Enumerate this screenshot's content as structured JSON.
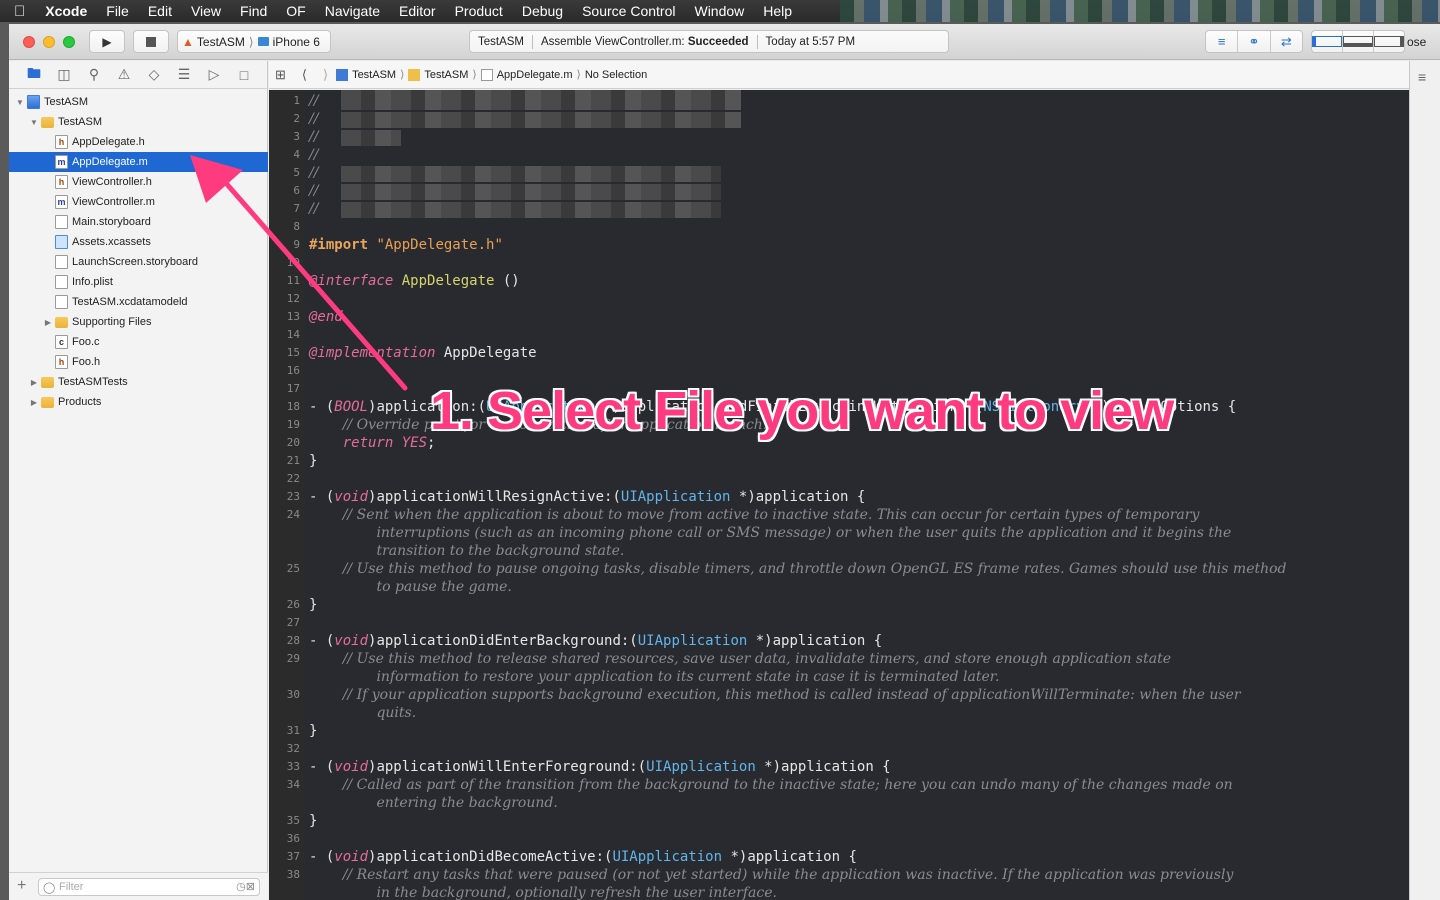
{
  "menubar": {
    "app": "Xcode",
    "items": [
      "File",
      "Edit",
      "View",
      "Find",
      "OF",
      "Navigate",
      "Editor",
      "Product",
      "Debug",
      "Source Control",
      "Window",
      "Help"
    ]
  },
  "toolbar": {
    "scheme": "TestASM",
    "device": "iPhone 6",
    "activity_project": "TestASM",
    "activity_status_prefix": "Assemble ViewController.m:",
    "activity_status": "Succeeded",
    "activity_time": "Today at 5:57 PM",
    "close_label": "ose"
  },
  "navigator": {
    "tree": [
      {
        "label": "TestASM",
        "icon": "project-icon",
        "indent": 0,
        "disclosure": "open"
      },
      {
        "label": "TestASM",
        "icon": "folder-icon",
        "indent": 1,
        "disclosure": "open"
      },
      {
        "label": "AppDelegate.h",
        "icon": "header-file-icon",
        "glyph": "h",
        "indent": 2
      },
      {
        "label": "AppDelegate.m",
        "icon": "objc-file-icon",
        "glyph": "m",
        "indent": 2,
        "selected": true
      },
      {
        "label": "ViewController.h",
        "icon": "header-file-icon",
        "glyph": "h",
        "indent": 2
      },
      {
        "label": "ViewController.m",
        "icon": "objc-file-icon",
        "glyph": "m",
        "indent": 2
      },
      {
        "label": "Main.storyboard",
        "icon": "storyboard-icon",
        "indent": 2
      },
      {
        "label": "Assets.xcassets",
        "icon": "asset-catalog-icon",
        "indent": 2
      },
      {
        "label": "LaunchScreen.storyboard",
        "icon": "storyboard-icon",
        "indent": 2
      },
      {
        "label": "Info.plist",
        "icon": "plist-icon",
        "indent": 2
      },
      {
        "label": "TestASM.xcdatamodeld",
        "icon": "datamodel-icon",
        "indent": 2
      },
      {
        "label": "Supporting Files",
        "icon": "folder-icon",
        "indent": 2,
        "disclosure": "closed"
      },
      {
        "label": "Foo.c",
        "icon": "c-file-icon",
        "glyph": "c",
        "indent": 2
      },
      {
        "label": "Foo.h",
        "icon": "header-file-icon",
        "glyph": "h",
        "indent": 2
      },
      {
        "label": "TestASMTests",
        "icon": "folder-icon",
        "indent": 1,
        "disclosure": "closed"
      },
      {
        "label": "Products",
        "icon": "folder-icon",
        "indent": 1,
        "disclosure": "closed"
      }
    ],
    "filter_placeholder": "Filter"
  },
  "jumpbar": {
    "crumbs": [
      "TestASM",
      "TestASM",
      "AppDelegate.m",
      "No Selection"
    ]
  },
  "editor": {
    "lines": [
      {
        "n": "1",
        "html": "<span class='cm'>//</span>"
      },
      {
        "n": "2",
        "html": "<span class='cm'>//</span>"
      },
      {
        "n": "3",
        "html": "<span class='cm'>//</span>"
      },
      {
        "n": "4",
        "html": "<span class='cm'>//</span>"
      },
      {
        "n": "5",
        "html": "<span class='cm'>//</span>"
      },
      {
        "n": "6",
        "html": "<span class='cm'>//</span>"
      },
      {
        "n": "7",
        "html": "<span class='cm'>//</span>"
      },
      {
        "n": "8",
        "html": ""
      },
      {
        "n": "9",
        "html": "<span class='pp'>#import</span> <span class='str'>\"AppDelegate.h\"</span>"
      },
      {
        "n": "10",
        "html": ""
      },
      {
        "n": "11",
        "html": "<span class='kw'>@interface</span> <span class='nm'>AppDelegate</span> ()"
      },
      {
        "n": "12",
        "html": ""
      },
      {
        "n": "13",
        "html": "<span class='kw'>@end</span>"
      },
      {
        "n": "14",
        "html": ""
      },
      {
        "n": "15",
        "html": "<span class='kw'>@implementation</span> AppDelegate"
      },
      {
        "n": "16",
        "html": ""
      },
      {
        "n": "17",
        "html": ""
      },
      {
        "n": "18",
        "html": "- (<span class='kw'>BOOL</span>)application:(<span class='cls'>UIApplication</span> *)application didFinishLaunchingWithOptions:(<span class='cls'>NSDictionary</span> *)launchOptions {"
      },
      {
        "n": "19",
        "html": "    <span class='cm'>// Override point for customization after application launch.</span>"
      },
      {
        "n": "20",
        "html": "    <span class='kw'>return</span> <span class='kw'>YES</span>;"
      },
      {
        "n": "21",
        "html": "}"
      },
      {
        "n": "22",
        "html": ""
      },
      {
        "n": "23",
        "html": "- (<span class='kw'>void</span>)applicationWillResignActive:(<span class='cls'>UIApplication</span> *)application {"
      },
      {
        "n": "24",
        "html": "    <span class='cm'>// Sent when the application is about to move from active to inactive state. This can occur for certain types of temporary</span>"
      },
      {
        "n": "",
        "html": "        <span class='cm'>interruptions (such as an incoming phone call or SMS message) or when the user quits the application and it begins the</span>"
      },
      {
        "n": "",
        "html": "        <span class='cm'>transition to the background state.</span>"
      },
      {
        "n": "25",
        "html": "    <span class='cm'>// Use this method to pause ongoing tasks, disable timers, and throttle down OpenGL ES frame rates. Games should use this method</span>"
      },
      {
        "n": "",
        "html": "        <span class='cm'>to pause the game.</span>"
      },
      {
        "n": "26",
        "html": "}"
      },
      {
        "n": "27",
        "html": ""
      },
      {
        "n": "28",
        "html": "- (<span class='kw'>void</span>)applicationDidEnterBackground:(<span class='cls'>UIApplication</span> *)application {"
      },
      {
        "n": "29",
        "html": "    <span class='cm'>// Use this method to release shared resources, save user data, invalidate timers, and store enough application state</span>"
      },
      {
        "n": "",
        "html": "        <span class='cm'>information to restore your application to its current state in case it is terminated later.</span>"
      },
      {
        "n": "30",
        "html": "    <span class='cm'>// If your application supports background execution, this method is called instead of applicationWillTerminate: when the user</span>"
      },
      {
        "n": "",
        "html": "        <span class='cm'>quits.</span>"
      },
      {
        "n": "31",
        "html": "}"
      },
      {
        "n": "32",
        "html": ""
      },
      {
        "n": "33",
        "html": "- (<span class='kw'>void</span>)applicationWillEnterForeground:(<span class='cls'>UIApplication</span> *)application {"
      },
      {
        "n": "34",
        "html": "    <span class='cm'>// Called as part of the transition from the background to the inactive state; here you can undo many of the changes made on</span>"
      },
      {
        "n": "",
        "html": "        <span class='cm'>entering the background.</span>"
      },
      {
        "n": "35",
        "html": "}"
      },
      {
        "n": "36",
        "html": ""
      },
      {
        "n": "37",
        "html": "- (<span class='kw'>void</span>)applicationDidBecomeActive:(<span class='cls'>UIApplication</span> *)application {"
      },
      {
        "n": "38",
        "html": "    <span class='cm'>// Restart any tasks that were paused (or not yet started) while the application was inactive. If the application was previously</span>"
      },
      {
        "n": "",
        "html": "        <span class='cm'>in the background, optionally refresh the user interface.</span>"
      }
    ]
  },
  "annotation": {
    "text": "1. Select File you want to view",
    "color": "#ff3b7f"
  }
}
